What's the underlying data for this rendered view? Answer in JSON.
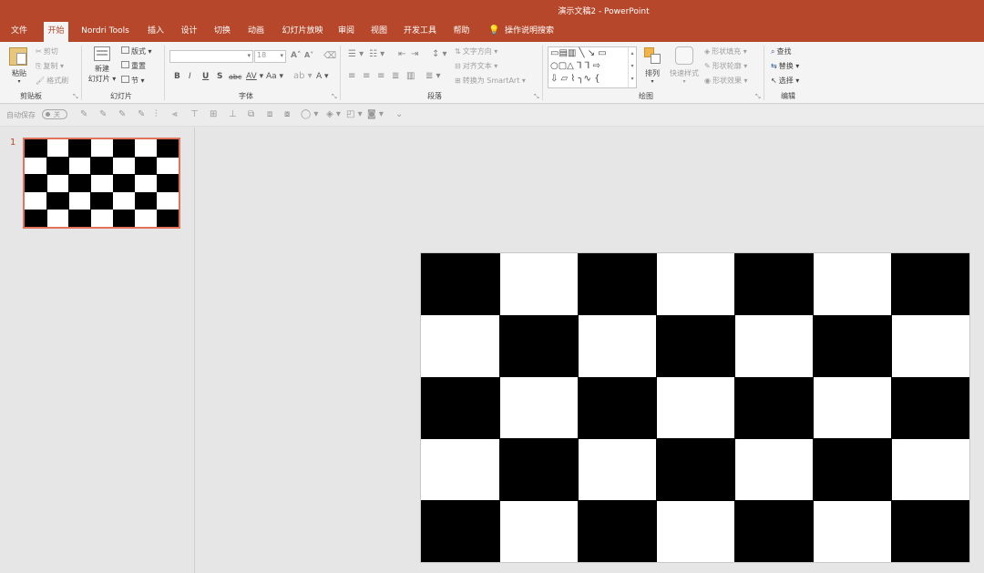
{
  "title_bar": {
    "title": "演示文稿2  -  PowerPoint"
  },
  "menu": {
    "tabs": [
      "文件",
      "开始",
      "Nordri Tools",
      "插入",
      "设计",
      "切换",
      "动画",
      "幻灯片放映",
      "审阅",
      "视图",
      "开发工具",
      "帮助"
    ],
    "active_index": 1,
    "search_label": "操作说明搜索",
    "search_icon": "lightbulb-icon"
  },
  "ribbon": {
    "clipboard": {
      "paste": "粘贴",
      "cut": "剪切",
      "copy": "复制",
      "format_painter": "格式刷",
      "label": "剪贴板"
    },
    "slides": {
      "new_slide_line1": "新建",
      "new_slide_line2": "幻灯片",
      "layout": "版式",
      "reset": "重置",
      "section": "节",
      "label": "幻灯片"
    },
    "font": {
      "font_name": "",
      "font_size": "18",
      "label": "字体",
      "bold": "B",
      "italic": "I",
      "underline": "U",
      "strike": "S",
      "abc": "abc",
      "spacing": "AV",
      "case": "Aa",
      "grow": "A",
      "shrink": "A"
    },
    "paragraph": {
      "text_direction": "文字方向",
      "align_text": "对齐文本",
      "smartart": "转换为 SmartArt",
      "label": "段落"
    },
    "drawing": {
      "arrange": "排列",
      "quick_styles": "快速样式",
      "shape_fill": "形状填充",
      "shape_outline": "形状轮廓",
      "shape_effects": "形状效果",
      "label": "绘图"
    },
    "editing": {
      "find": "查找",
      "replace": "替换",
      "select": "选择",
      "label": "编辑"
    }
  },
  "qat": {
    "autosave": "自动保存",
    "toggle_state": "关"
  },
  "slides_pane": {
    "slide_number": "1"
  },
  "slide": {
    "rows": 5,
    "cols": 7,
    "top_left_black": true
  },
  "colors": {
    "accent": "#b7472a",
    "selection_border": "#e0735a"
  }
}
